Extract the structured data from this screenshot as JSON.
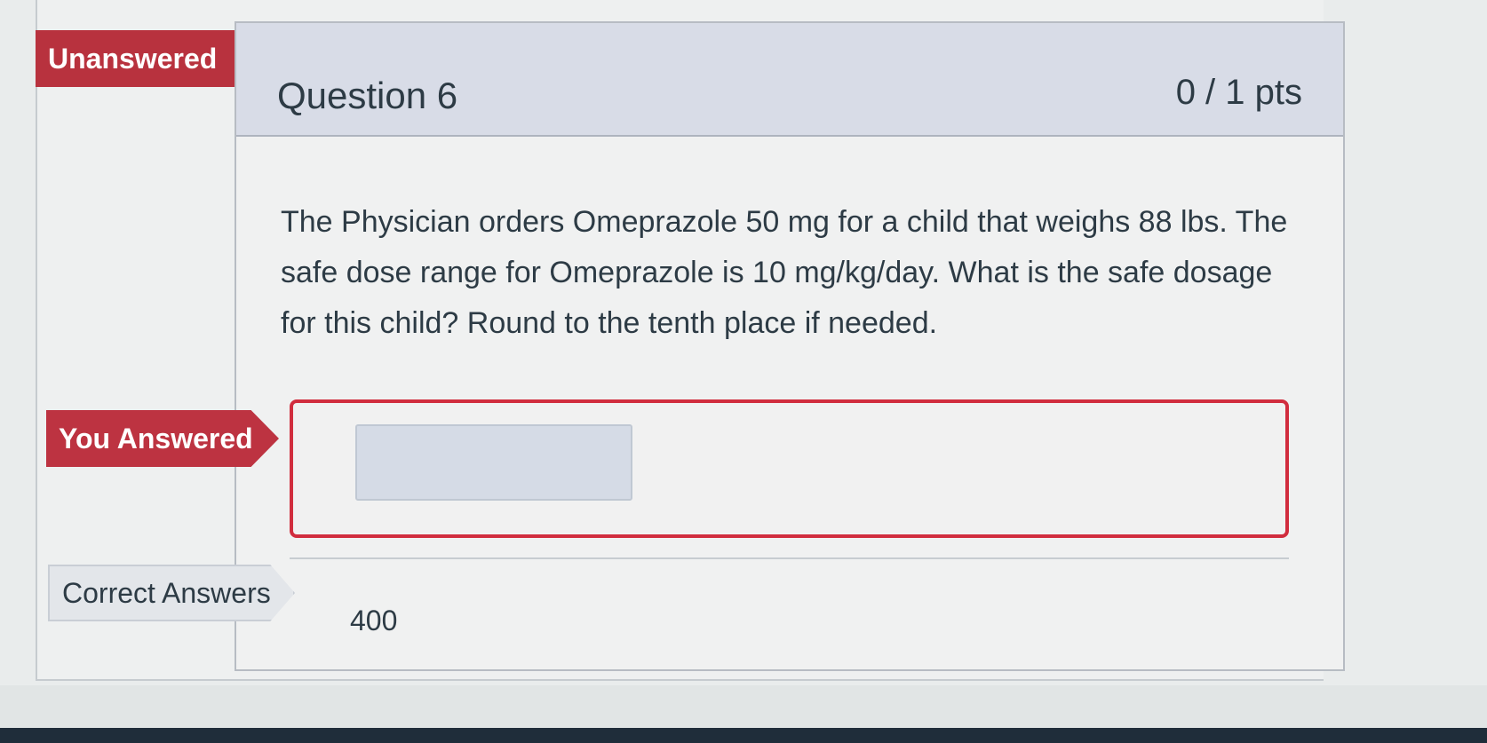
{
  "tags": {
    "unanswered": "Unanswered",
    "you_answered": "You Answered",
    "correct_answers": "Correct Answers"
  },
  "question": {
    "title": "Question 6",
    "points": "0 / 1 pts",
    "text": "The Physician orders Omeprazole 50 mg  for a child that weighs 88 lbs. The safe dose range for Omeprazole is 10  mg/kg/day. What is the safe dosage for this child? Round to the tenth place if needed.",
    "answer_input_value": "",
    "correct_answer": "400"
  },
  "colors": {
    "header_bg": "#d8dce7",
    "incorrect_red": "#d12d3e",
    "tag_red": "#b8323e",
    "text_dark": "#2d3b45"
  }
}
